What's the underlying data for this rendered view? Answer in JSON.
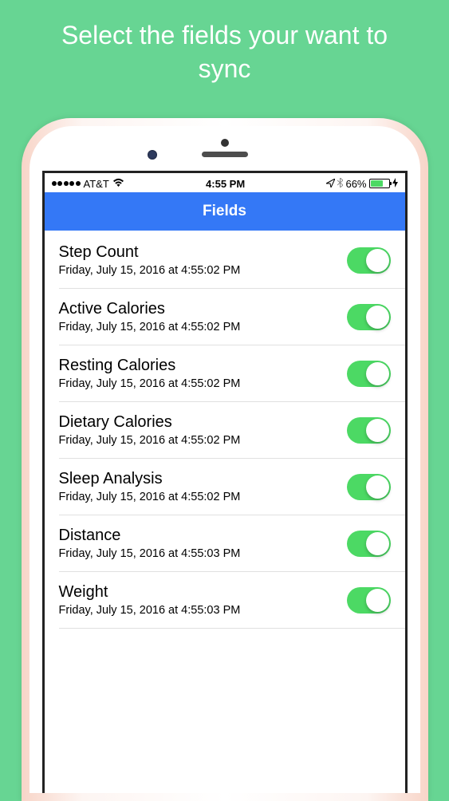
{
  "promo": {
    "text": "Select the fields your want to sync"
  },
  "status_bar": {
    "carrier": "AT&T",
    "time": "4:55 PM",
    "battery_pct": "66%"
  },
  "nav": {
    "title": "Fields"
  },
  "fields": [
    {
      "title": "Step Count",
      "subtitle": "Friday, July 15, 2016 at 4:55:02 PM",
      "on": true
    },
    {
      "title": "Active Calories",
      "subtitle": "Friday, July 15, 2016 at 4:55:02 PM",
      "on": true
    },
    {
      "title": "Resting Calories",
      "subtitle": "Friday, July 15, 2016 at 4:55:02 PM",
      "on": true
    },
    {
      "title": "Dietary Calories",
      "subtitle": "Friday, July 15, 2016 at 4:55:02 PM",
      "on": true
    },
    {
      "title": "Sleep Analysis",
      "subtitle": "Friday, July 15, 2016 at 4:55:02 PM",
      "on": true
    },
    {
      "title": "Distance",
      "subtitle": "Friday, July 15, 2016 at 4:55:03 PM",
      "on": true
    },
    {
      "title": "Weight",
      "subtitle": "Friday, July 15, 2016 at 4:55:03 PM",
      "on": true
    }
  ]
}
